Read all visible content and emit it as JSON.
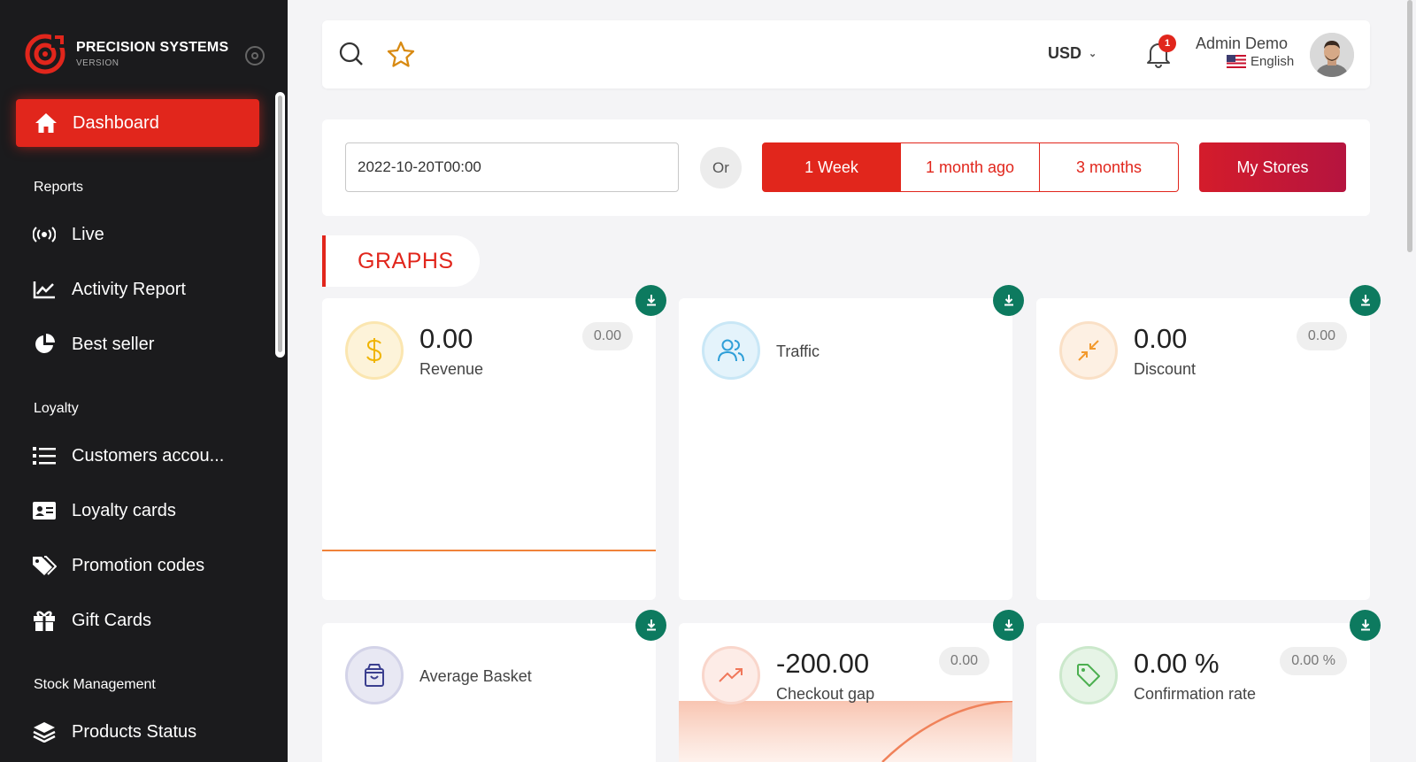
{
  "brand": {
    "name": "PRECISION SYSTEMS",
    "sub": "VERSION"
  },
  "nav": {
    "active": {
      "label": "Dashboard",
      "icon": "home-icon"
    },
    "sections": {
      "reports": "Reports",
      "loyalty": "Loyalty",
      "stock": "Stock Management"
    },
    "items": [
      {
        "label": "Live",
        "icon": "broadcast-icon"
      },
      {
        "label": "Activity Report",
        "icon": "line-chart-icon"
      },
      {
        "label": "Best seller",
        "icon": "pie-chart-icon"
      },
      {
        "label": "Customers accou...",
        "icon": "list-icon"
      },
      {
        "label": "Loyalty cards",
        "icon": "id-card-icon"
      },
      {
        "label": "Promotion codes",
        "icon": "tags-icon"
      },
      {
        "label": "Gift Cards",
        "icon": "gift-icon"
      },
      {
        "label": "Products Status",
        "icon": "layers-icon"
      }
    ]
  },
  "topbar": {
    "currency": "USD",
    "notifications_count": "1",
    "user_name": "Admin Demo",
    "language": "English"
  },
  "filters": {
    "date_value": "2022-10-20T00:00",
    "or_label": "Or",
    "ranges": [
      "1 Week",
      "1 month ago",
      "3 months"
    ],
    "active_range": "1 Week",
    "stores_label": "My Stores"
  },
  "graphs_heading": "GRAPHS",
  "cards": [
    {
      "value": "0.00",
      "label": "Revenue",
      "badge": "0.00",
      "icon": "dollar-icon",
      "icon_color": "#f0b400"
    },
    {
      "value": "",
      "label": "Traffic",
      "badge": "",
      "icon": "users-icon",
      "icon_color": "#2f9fd8"
    },
    {
      "value": "0.00",
      "label": "Discount",
      "badge": "0.00",
      "icon": "compress-icon",
      "icon_color": "#f29a2e"
    },
    {
      "value": "",
      "label": "Average Basket",
      "badge": "",
      "icon": "shopping-bag-icon",
      "icon_color": "#3b3f8f"
    },
    {
      "value": "-200.00",
      "label": "Checkout gap",
      "badge": "0.00",
      "icon": "trending-up-icon",
      "icon_color": "#f0775a"
    },
    {
      "value": "0.00 %",
      "label": "Confirmation rate",
      "badge": "0.00 %",
      "icon": "tag-icon",
      "icon_color": "#4caf50"
    }
  ],
  "colors": {
    "accent": "#e1261c",
    "sidebar": "#1b1b1d",
    "download": "#0d7a5f"
  }
}
